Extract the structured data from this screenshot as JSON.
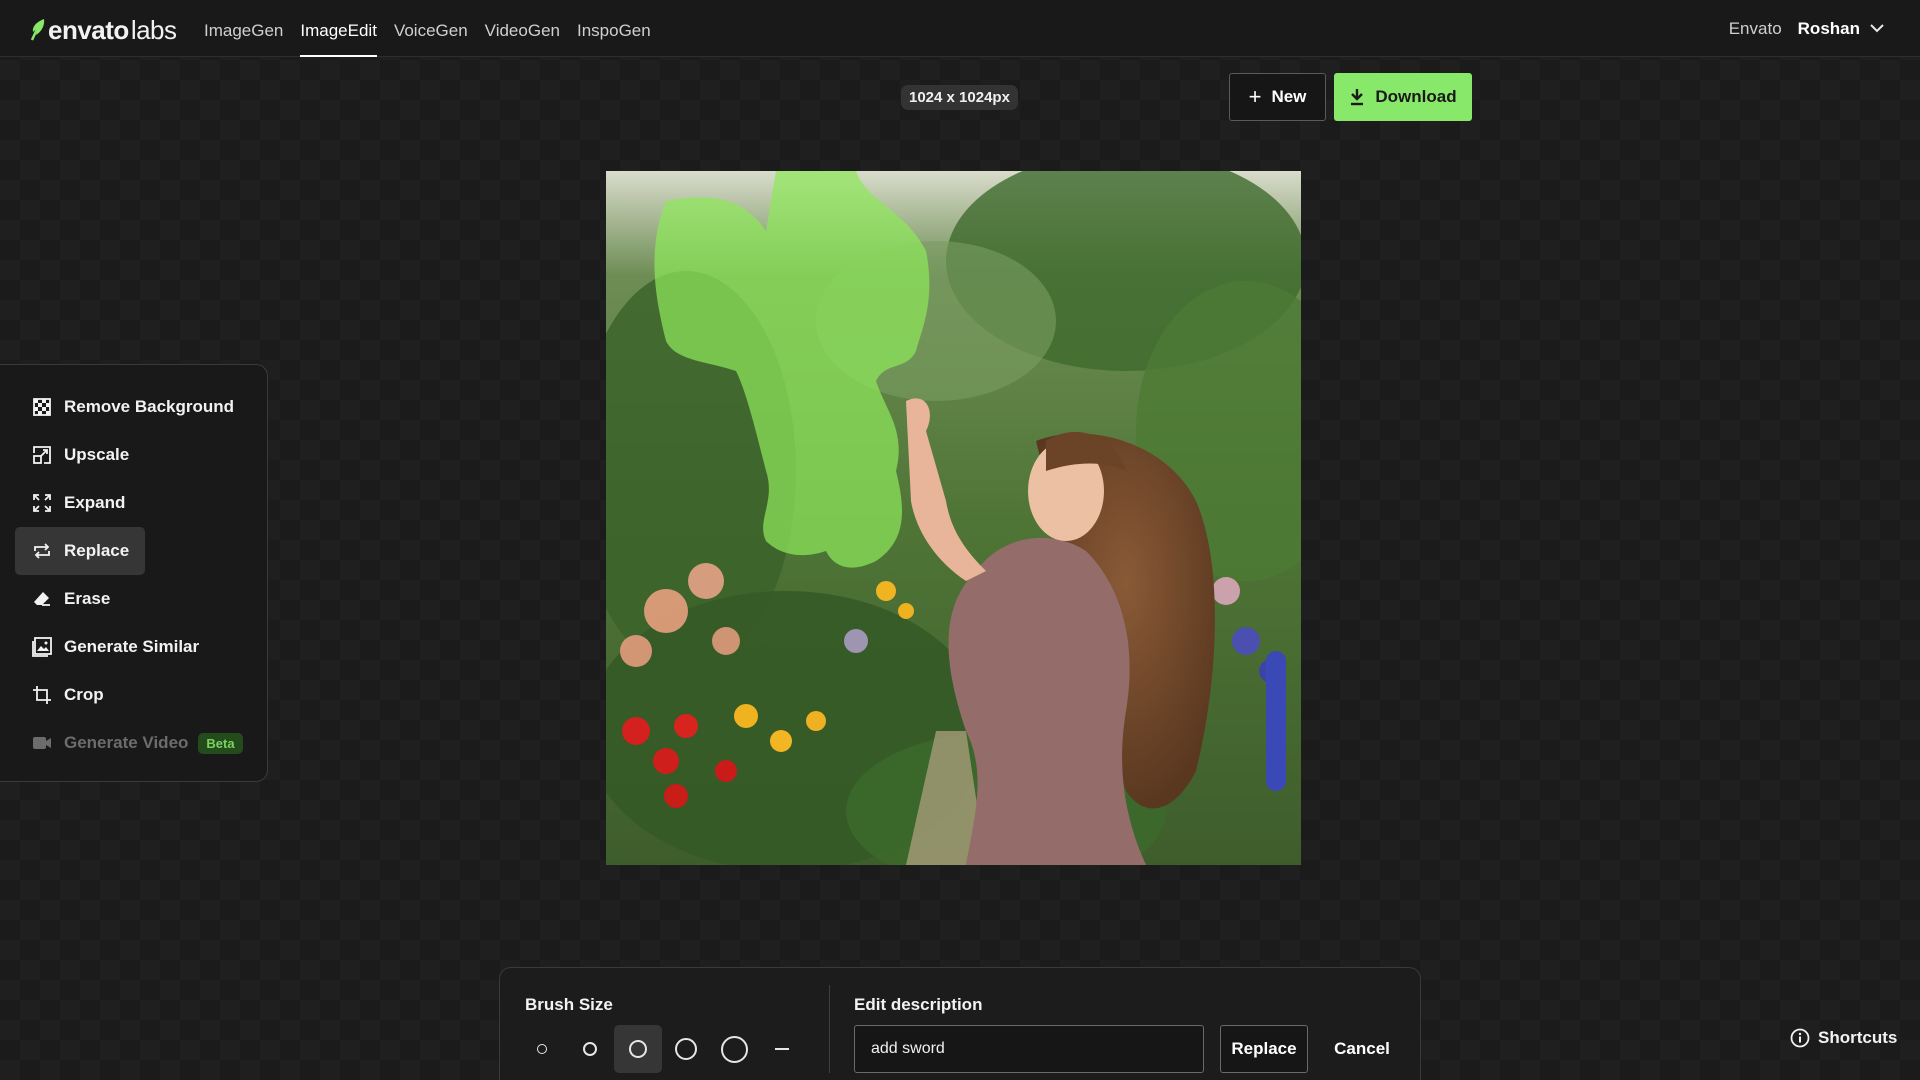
{
  "app": {
    "logo_main": "envato",
    "logo_sub": "labs"
  },
  "nav": {
    "items": [
      {
        "label": "ImageGen"
      },
      {
        "label": "ImageEdit",
        "active": true
      },
      {
        "label": "VoiceGen"
      },
      {
        "label": "VideoGen"
      },
      {
        "label": "InspoGen"
      }
    ],
    "envato_link": "Envato",
    "user_name": "Roshan"
  },
  "toolbar": {
    "size_badge": "1024 x 1024px",
    "new_label": "New",
    "download_label": "Download"
  },
  "tools": {
    "items": [
      {
        "label": "Remove Background",
        "icon": "checkerboard-icon"
      },
      {
        "label": "Upscale",
        "icon": "upscale-icon"
      },
      {
        "label": "Expand",
        "icon": "expand-icon"
      },
      {
        "label": "Replace",
        "icon": "replace-icon",
        "active": true
      },
      {
        "label": "Erase",
        "icon": "eraser-icon"
      },
      {
        "label": "Generate Similar",
        "icon": "image-icon"
      },
      {
        "label": "Crop",
        "icon": "crop-icon"
      },
      {
        "label": "Generate Video",
        "icon": "video-camera-icon",
        "disabled": true,
        "badge": "Beta"
      }
    ]
  },
  "editor": {
    "brush_label": "Brush Size",
    "brush_sizes": [
      "xs",
      "s",
      "m",
      "l",
      "xl",
      "line"
    ],
    "selected_brush": "m",
    "edit_label": "Edit description",
    "edit_value": "add sword",
    "replace_label": "Replace",
    "cancel_label": "Cancel"
  },
  "shortcuts_label": "Shortcuts",
  "colors": {
    "accent": "#87e86a",
    "mask": "#8ee85a",
    "background": "#1b1b1b"
  }
}
